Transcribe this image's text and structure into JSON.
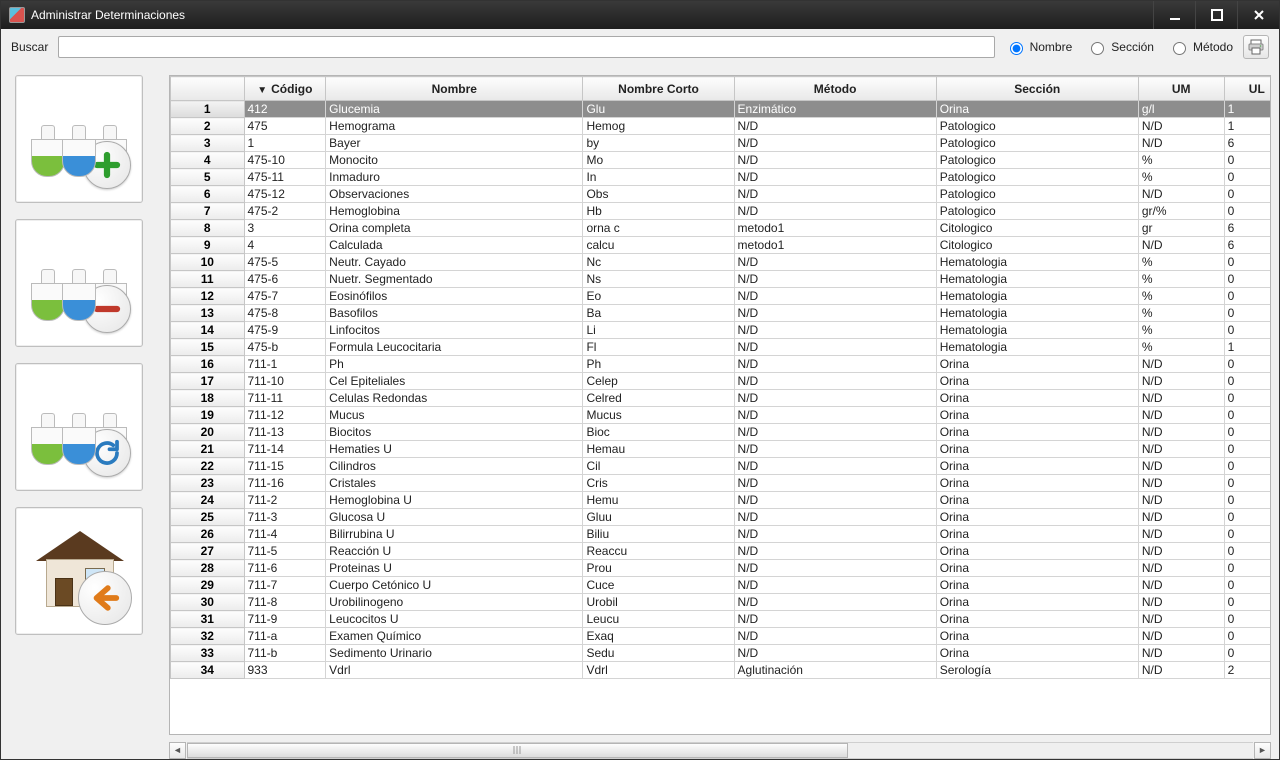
{
  "window": {
    "title": "Administrar Determinaciones"
  },
  "toolbar": {
    "search_label": "Buscar",
    "search_value": "",
    "radio_nombre": "Nombre",
    "radio_seccion": "Sección",
    "radio_metodo": "Método",
    "radio_selected": "nombre"
  },
  "sidebar": {
    "add": "add-determination",
    "remove": "remove-determination",
    "refresh": "refresh",
    "home": "home-back"
  },
  "columns": {
    "codigo": "Código",
    "nombre": "Nombre",
    "nombre_corto": "Nombre Corto",
    "metodo": "Método",
    "seccion": "Sección",
    "um": "UM",
    "ul": "UL"
  },
  "selected_row_index": 0,
  "rows": [
    {
      "n": "1",
      "codigo": "412",
      "nombre": "Glucemia",
      "nc": "Glu",
      "metodo": "Enzimático",
      "seccion": "Orina",
      "um": "g/l",
      "ul": "1"
    },
    {
      "n": "2",
      "codigo": "475",
      "nombre": "Hemograma",
      "nc": "Hemog",
      "metodo": "N/D",
      "seccion": "Patologico",
      "um": "N/D",
      "ul": "1"
    },
    {
      "n": "3",
      "codigo": "1",
      "nombre": "Bayer",
      "nc": "by",
      "metodo": "N/D",
      "seccion": "Patologico",
      "um": "N/D",
      "ul": "6"
    },
    {
      "n": "4",
      "codigo": "475-10",
      "nombre": "Monocito",
      "nc": "Mo",
      "metodo": "N/D",
      "seccion": "Patologico",
      "um": "%",
      "ul": "0"
    },
    {
      "n": "5",
      "codigo": "475-11",
      "nombre": "Inmaduro",
      "nc": "In",
      "metodo": "N/D",
      "seccion": "Patologico",
      "um": "%",
      "ul": "0"
    },
    {
      "n": "6",
      "codigo": "475-12",
      "nombre": "Observaciones",
      "nc": "Obs",
      "metodo": "N/D",
      "seccion": "Patologico",
      "um": "N/D",
      "ul": "0"
    },
    {
      "n": "7",
      "codigo": "475-2",
      "nombre": "Hemoglobina",
      "nc": "Hb",
      "metodo": "N/D",
      "seccion": "Patologico",
      "um": "gr/%",
      "ul": "0"
    },
    {
      "n": "8",
      "codigo": "3",
      "nombre": "Orina completa",
      "nc": "orna c",
      "metodo": "metodo1",
      "seccion": "Citologico",
      "um": "gr",
      "ul": "6"
    },
    {
      "n": "9",
      "codigo": "4",
      "nombre": "Calculada",
      "nc": "calcu",
      "metodo": "metodo1",
      "seccion": "Citologico",
      "um": "N/D",
      "ul": "6"
    },
    {
      "n": "10",
      "codigo": "475-5",
      "nombre": "Neutr. Cayado",
      "nc": "Nc",
      "metodo": "N/D",
      "seccion": "Hematologia",
      "um": "%",
      "ul": "0"
    },
    {
      "n": "11",
      "codigo": "475-6",
      "nombre": "Nuetr. Segmentado",
      "nc": "Ns",
      "metodo": "N/D",
      "seccion": "Hematologia",
      "um": "%",
      "ul": "0"
    },
    {
      "n": "12",
      "codigo": "475-7",
      "nombre": "Eosinófilos",
      "nc": "Eo",
      "metodo": "N/D",
      "seccion": "Hematologia",
      "um": "%",
      "ul": "0"
    },
    {
      "n": "13",
      "codigo": "475-8",
      "nombre": "Basofilos",
      "nc": "Ba",
      "metodo": "N/D",
      "seccion": "Hematologia",
      "um": "%",
      "ul": "0"
    },
    {
      "n": "14",
      "codigo": "475-9",
      "nombre": "Linfocitos",
      "nc": "Li",
      "metodo": "N/D",
      "seccion": "Hematologia",
      "um": "%",
      "ul": "0"
    },
    {
      "n": "15",
      "codigo": "475-b",
      "nombre": "Formula Leucocitaria",
      "nc": "Fl",
      "metodo": "N/D",
      "seccion": "Hematologia",
      "um": "%",
      "ul": "1"
    },
    {
      "n": "16",
      "codigo": "711-1",
      "nombre": "Ph",
      "nc": "Ph",
      "metodo": "N/D",
      "seccion": "Orina",
      "um": "N/D",
      "ul": "0"
    },
    {
      "n": "17",
      "codigo": "711-10",
      "nombre": "Cel Epiteliales",
      "nc": "Celep",
      "metodo": "N/D",
      "seccion": "Orina",
      "um": "N/D",
      "ul": "0"
    },
    {
      "n": "18",
      "codigo": "711-11",
      "nombre": "Celulas Redondas",
      "nc": "Celred",
      "metodo": "N/D",
      "seccion": "Orina",
      "um": "N/D",
      "ul": "0"
    },
    {
      "n": "19",
      "codigo": "711-12",
      "nombre": "Mucus",
      "nc": "Mucus",
      "metodo": "N/D",
      "seccion": "Orina",
      "um": "N/D",
      "ul": "0"
    },
    {
      "n": "20",
      "codigo": "711-13",
      "nombre": "Biocitos",
      "nc": "Bioc",
      "metodo": "N/D",
      "seccion": "Orina",
      "um": "N/D",
      "ul": "0"
    },
    {
      "n": "21",
      "codigo": "711-14",
      "nombre": "Hematies U",
      "nc": "Hemau",
      "metodo": "N/D",
      "seccion": "Orina",
      "um": "N/D",
      "ul": "0"
    },
    {
      "n": "22",
      "codigo": "711-15",
      "nombre": "Cilindros",
      "nc": "Cil",
      "metodo": "N/D",
      "seccion": "Orina",
      "um": "N/D",
      "ul": "0"
    },
    {
      "n": "23",
      "codigo": "711-16",
      "nombre": "Cristales",
      "nc": "Cris",
      "metodo": "N/D",
      "seccion": "Orina",
      "um": "N/D",
      "ul": "0"
    },
    {
      "n": "24",
      "codigo": "711-2",
      "nombre": "Hemoglobina U",
      "nc": "Hemu",
      "metodo": "N/D",
      "seccion": "Orina",
      "um": "N/D",
      "ul": "0"
    },
    {
      "n": "25",
      "codigo": "711-3",
      "nombre": "Glucosa U",
      "nc": "Gluu",
      "metodo": "N/D",
      "seccion": "Orina",
      "um": "N/D",
      "ul": "0"
    },
    {
      "n": "26",
      "codigo": "711-4",
      "nombre": "Bilirrubina U",
      "nc": "Biliu",
      "metodo": "N/D",
      "seccion": "Orina",
      "um": "N/D",
      "ul": "0"
    },
    {
      "n": "27",
      "codigo": "711-5",
      "nombre": "Reacción U",
      "nc": "Reaccu",
      "metodo": "N/D",
      "seccion": "Orina",
      "um": "N/D",
      "ul": "0"
    },
    {
      "n": "28",
      "codigo": "711-6",
      "nombre": "Proteinas U",
      "nc": "Prou",
      "metodo": "N/D",
      "seccion": "Orina",
      "um": "N/D",
      "ul": "0"
    },
    {
      "n": "29",
      "codigo": "711-7",
      "nombre": "Cuerpo Cetónico U",
      "nc": "Cuce",
      "metodo": "N/D",
      "seccion": "Orina",
      "um": "N/D",
      "ul": "0"
    },
    {
      "n": "30",
      "codigo": "711-8",
      "nombre": "Urobilinogeno",
      "nc": "Urobil",
      "metodo": "N/D",
      "seccion": "Orina",
      "um": "N/D",
      "ul": "0"
    },
    {
      "n": "31",
      "codigo": "711-9",
      "nombre": "Leucocitos U",
      "nc": "Leucu",
      "metodo": "N/D",
      "seccion": "Orina",
      "um": "N/D",
      "ul": "0"
    },
    {
      "n": "32",
      "codigo": "711-a",
      "nombre": "Examen Químico",
      "nc": "Exaq",
      "metodo": "N/D",
      "seccion": "Orina",
      "um": "N/D",
      "ul": "0"
    },
    {
      "n": "33",
      "codigo": "711-b",
      "nombre": "Sedimento Urinario",
      "nc": "Sedu",
      "metodo": "N/D",
      "seccion": "Orina",
      "um": "N/D",
      "ul": "0"
    },
    {
      "n": "34",
      "codigo": "933",
      "nombre": "Vdrl",
      "nc": "Vdrl",
      "metodo": "Aglutinación",
      "seccion": "Serología",
      "um": "N/D",
      "ul": "2"
    }
  ]
}
